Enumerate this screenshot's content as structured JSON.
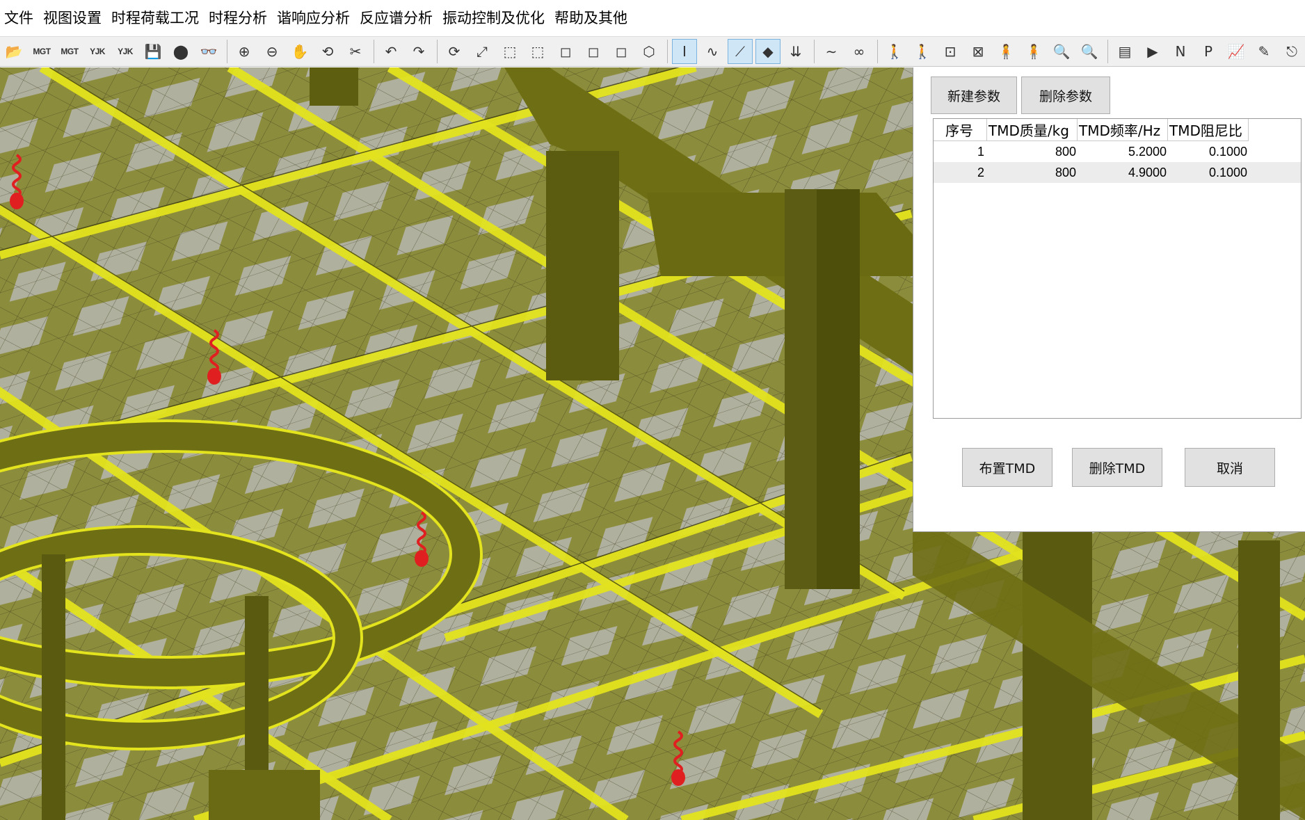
{
  "menu": [
    "文件",
    "视图设置",
    "时程荷载工况",
    "时程分析",
    "谐响应分析",
    "反应谱分析",
    "振动控制及优化",
    "帮助及其他"
  ],
  "toolbar": {
    "groups": [
      [
        {
          "name": "open-folder-icon",
          "glyph": "📂"
        },
        {
          "name": "import-mgt-icon",
          "text": "MGT"
        },
        {
          "name": "export-mgt-icon",
          "text": "MGT"
        },
        {
          "name": "import-yjk-icon",
          "text": "YJK"
        },
        {
          "name": "export-yjk-icon",
          "text": "YJK"
        },
        {
          "name": "save-icon",
          "glyph": "💾"
        },
        {
          "name": "render-shape-icon",
          "glyph": "⬤"
        },
        {
          "name": "glasses-view-icon",
          "glyph": "👓"
        }
      ],
      [
        {
          "name": "zoom-in-icon",
          "glyph": "⊕"
        },
        {
          "name": "zoom-out-icon",
          "glyph": "⊖"
        },
        {
          "name": "pan-hand-icon",
          "glyph": "✋"
        },
        {
          "name": "rotate-view-icon",
          "glyph": "⟲"
        },
        {
          "name": "clip-view-icon",
          "glyph": "✂"
        }
      ],
      [
        {
          "name": "undo-icon",
          "glyph": "↶"
        },
        {
          "name": "redo-icon",
          "glyph": "↷"
        }
      ],
      [
        {
          "name": "refresh-model-icon",
          "glyph": "⟳"
        },
        {
          "name": "fit-window-icon",
          "glyph": "⤢"
        },
        {
          "name": "select-node-icon",
          "glyph": "⬚"
        },
        {
          "name": "select-element-icon",
          "glyph": "⬚"
        },
        {
          "name": "front-view-icon",
          "glyph": "◻"
        },
        {
          "name": "side-view-icon",
          "glyph": "◻"
        },
        {
          "name": "top-view-icon",
          "glyph": "◻"
        },
        {
          "name": "iso-view-icon",
          "glyph": "⬡"
        }
      ],
      [
        {
          "name": "beam-section-icon",
          "glyph": "Ⅰ",
          "active": true
        },
        {
          "name": "spring-link-icon",
          "glyph": "∿"
        },
        {
          "name": "line-element-icon",
          "glyph": "⟋",
          "active": true
        },
        {
          "name": "plate-element-icon",
          "glyph": "◆",
          "active": true
        },
        {
          "name": "load-arrows-icon",
          "glyph": "⇊"
        }
      ],
      [
        {
          "name": "wave-icon",
          "glyph": "∼"
        },
        {
          "name": "infinity-icon",
          "glyph": "∞"
        }
      ],
      [
        {
          "name": "walker-add-icon",
          "glyph": "🚶"
        },
        {
          "name": "walker-remove-icon",
          "glyph": "🚶"
        },
        {
          "name": "node-person-icon",
          "glyph": "⊡"
        },
        {
          "name": "node-red-icon",
          "glyph": "⊠"
        },
        {
          "name": "person-add-icon",
          "glyph": "🧍"
        },
        {
          "name": "person-remove-icon",
          "glyph": "🧍"
        },
        {
          "name": "search-add-icon",
          "glyph": "🔍"
        },
        {
          "name": "search-remove-icon",
          "glyph": "🔍"
        }
      ],
      [
        {
          "name": "table-icon",
          "glyph": "▤"
        },
        {
          "name": "run-icon",
          "glyph": "▶"
        },
        {
          "name": "n-letter-icon",
          "glyph": "N"
        },
        {
          "name": "p-letter-icon",
          "glyph": "P"
        },
        {
          "name": "chart-icon",
          "glyph": "📈"
        },
        {
          "name": "edit-disabled-icon",
          "glyph": "✎"
        },
        {
          "name": "exit-icon",
          "glyph": "⎋"
        }
      ]
    ]
  },
  "dialog": {
    "new_param_label": "新建参数",
    "delete_param_label": "删除参数",
    "columns": [
      "序号",
      "TMD质量/kg",
      "TMD频率/Hz",
      "TMD阻尼比"
    ],
    "rows": [
      [
        "1",
        "800",
        "5.2000",
        "0.1000"
      ],
      [
        "2",
        "800",
        "4.9000",
        "0.1000"
      ]
    ],
    "place_tmd_label": "布置TMD",
    "delete_tmd_label": "删除TMD",
    "cancel_label": "取消"
  },
  "colors": {
    "beam_yellow": "#e0e020",
    "solid_olive": "#6b6b12",
    "mesh_olive": "#8a8a3a",
    "slab_grey": "#b4b4b4",
    "tmd_red": "#e02020",
    "toolbar_bg": "#f0f0f0"
  }
}
